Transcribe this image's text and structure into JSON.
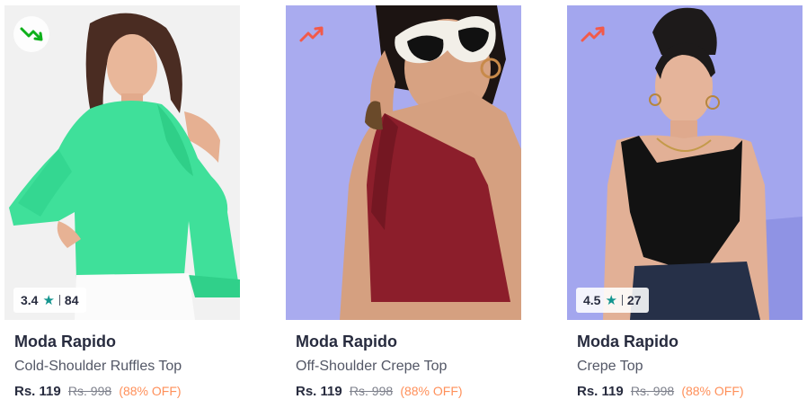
{
  "colors": {
    "trend_down": "#0db01a",
    "trend_up": "#f25a4a",
    "star": "#14958f",
    "discount": "#ff905a"
  },
  "products": [
    {
      "brand": "Moda Rapido",
      "name": "Cold-Shoulder Ruffles Top",
      "price": "Rs. 119",
      "mrp": "Rs. 998",
      "discount": "(88% OFF)",
      "trend_icon": "trend-down-icon",
      "rating": "3.4",
      "rating_count": "84"
    },
    {
      "brand": "Moda Rapido",
      "name": "Off-Shoulder Crepe Top",
      "price": "Rs. 119",
      "mrp": "Rs. 998",
      "discount": "(88% OFF)",
      "trend_icon": "trend-up-icon",
      "rating": "",
      "rating_count": ""
    },
    {
      "brand": "Moda Rapido",
      "name": "Crepe Top",
      "price": "Rs. 119",
      "mrp": "Rs. 998",
      "discount": "(88% OFF)",
      "trend_icon": "trend-up-icon",
      "rating": "4.5",
      "rating_count": "27"
    }
  ]
}
